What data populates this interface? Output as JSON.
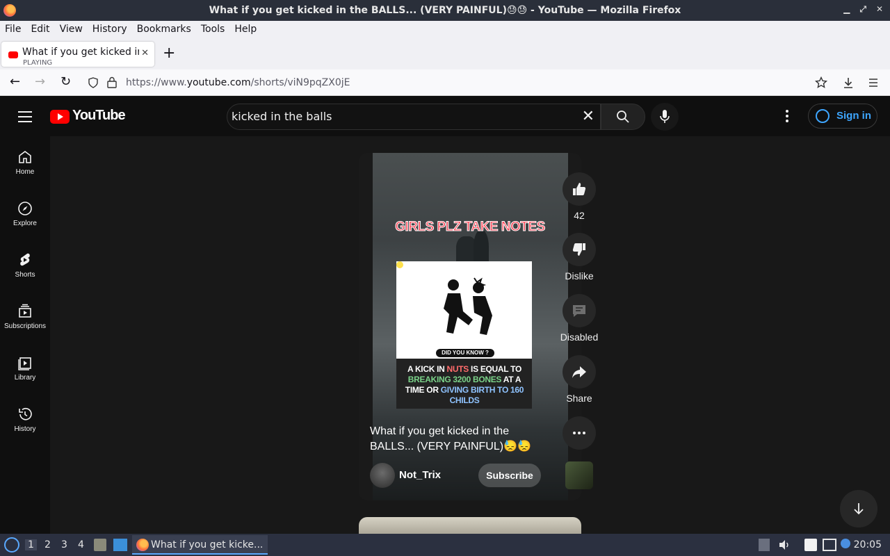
{
  "window": {
    "title": "What if you get kicked in the BALLS... (VERY PAINFUL)😓😓 - YouTube — Mozilla Firefox"
  },
  "menubar": [
    "File",
    "Edit",
    "View",
    "History",
    "Bookmarks",
    "Tools",
    "Help"
  ],
  "tab": {
    "title": "What if you get kicked in the BALLS",
    "subtitle": "PLAYING",
    "close": "✕"
  },
  "newtab": "+",
  "url": {
    "prefix": "https://www.",
    "domain": "youtube.com",
    "path": "/shorts/viN9pqZX0jE"
  },
  "youtube": {
    "logo_text": "YouTube",
    "search_value": "kicked in the balls",
    "signin_label": "Sign in",
    "sidebar": [
      {
        "label": "Home",
        "icon": "home-icon"
      },
      {
        "label": "Explore",
        "icon": "compass-icon"
      },
      {
        "label": "Shorts",
        "icon": "shorts-icon"
      },
      {
        "label": "Subscriptions",
        "icon": "subscriptions-icon"
      },
      {
        "label": "Library",
        "icon": "library-icon"
      },
      {
        "label": "History",
        "icon": "history-icon"
      }
    ]
  },
  "short": {
    "overlay_heading": "GIRLS PLZ TAKE NOTES",
    "did_you_know": "DID YOU KNOW ?",
    "fact_parts": [
      "A KICK IN ",
      "NUTS",
      " IS EQUAL TO ",
      "BREAKING 3200 BONES",
      " AT A TIME OR ",
      "GIVING BIRTH TO 160",
      " CHILDS"
    ],
    "caption": "What if you get kicked in the BALLS... (VERY PAINFUL)😓😓",
    "channel": "Not_Trix",
    "subscribe_label": "Subscribe",
    "actions": {
      "like_count": "42",
      "dislike_label": "Dislike",
      "comments_label": "Disabled",
      "share_label": "Share"
    }
  },
  "taskbar": {
    "workspaces": [
      "1",
      "2",
      "3",
      "4"
    ],
    "task_title": "What if you get kicke...",
    "clock": "20:05"
  },
  "colors": {
    "yt_red": "#ff0000",
    "link_blue": "#3ea6ff",
    "heading_red": "#ff4b5c"
  }
}
